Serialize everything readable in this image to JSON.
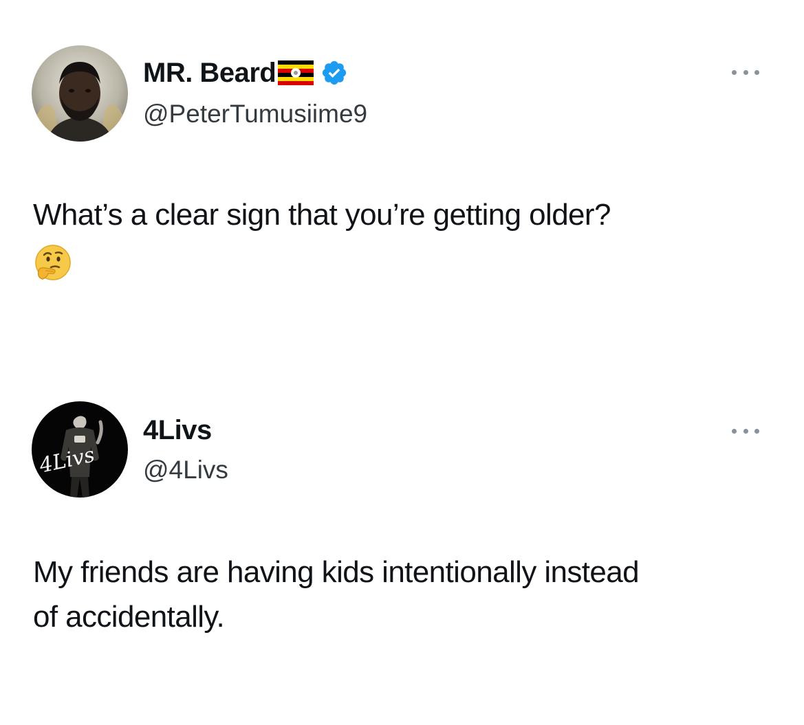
{
  "tweets": [
    {
      "display_name": "MR. Beard",
      "handle": "@PeterTumusiime9",
      "text": "What’s a clear sign that you’re getting older?",
      "icons": [
        "avatar-photo",
        "uganda-flag-icon",
        "verified-badge-icon",
        "thinking-face-emoji",
        "more-options-icon"
      ]
    },
    {
      "display_name": "4Livs",
      "handle": "@4Livs",
      "text": "My friends are having kids intentionally instead of accidentally.",
      "avatar_signature": "4Livs",
      "icons": [
        "avatar-photo",
        "more-options-icon"
      ]
    }
  ],
  "colors": {
    "verified": "#1d9bf0",
    "text": "#0f1419",
    "handle": "#333a40",
    "background": "#ffffff"
  }
}
